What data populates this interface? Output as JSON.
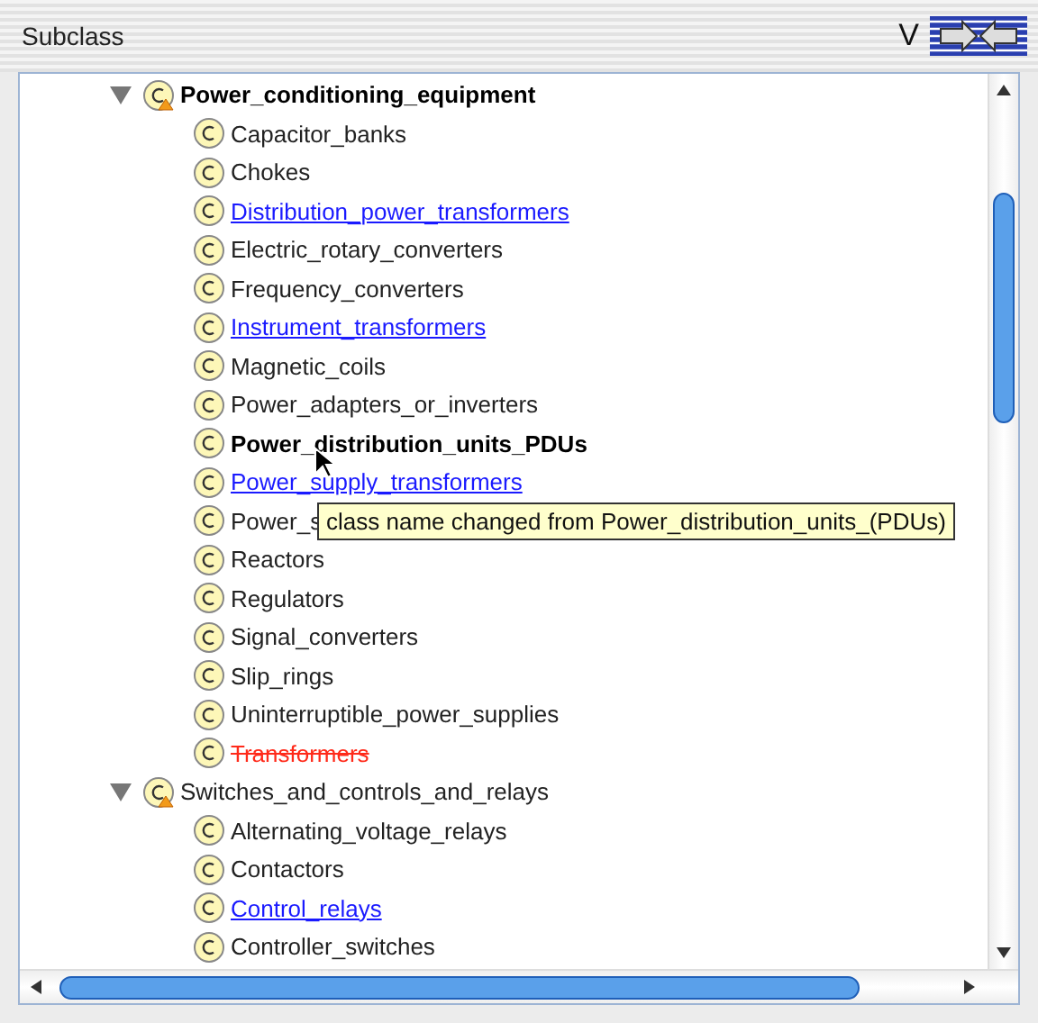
{
  "panel": {
    "title": "Subclass",
    "view_label": "V"
  },
  "tree": [
    {
      "label": "Power_conditioning_equipment",
      "kind": "bold",
      "expanded": true,
      "warning": true,
      "children": [
        {
          "label": "Capacitor_banks",
          "kind": "normal"
        },
        {
          "label": "Chokes",
          "kind": "normal"
        },
        {
          "label": "Distribution_power_transformers",
          "kind": "link"
        },
        {
          "label": "Electric_rotary_converters",
          "kind": "normal"
        },
        {
          "label": "Frequency_converters",
          "kind": "normal"
        },
        {
          "label": "Instrument_transformers",
          "kind": "link"
        },
        {
          "label": "Magnetic_coils",
          "kind": "normal"
        },
        {
          "label": "Power_adapters_or_inverters",
          "kind": "normal"
        },
        {
          "label": "Power_distribution_units_PDUs",
          "kind": "bold"
        },
        {
          "label": "Power_supply_transformers",
          "kind": "link"
        },
        {
          "label": "Power_s",
          "kind": "normal"
        },
        {
          "label": "Reactors",
          "kind": "normal"
        },
        {
          "label": "Regulators",
          "kind": "normal"
        },
        {
          "label": "Signal_converters",
          "kind": "normal"
        },
        {
          "label": "Slip_rings",
          "kind": "normal"
        },
        {
          "label": "Uninterruptible_power_supplies",
          "kind": "normal"
        },
        {
          "label": "Transformers",
          "kind": "deleted"
        }
      ]
    },
    {
      "label": "Switches_and_controls_and_relays",
      "kind": "normal",
      "expanded": true,
      "warning": true,
      "children": [
        {
          "label": "Alternating_voltage_relays",
          "kind": "normal"
        },
        {
          "label": "Contactors",
          "kind": "normal"
        },
        {
          "label": "Control_relays",
          "kind": "link"
        },
        {
          "label": "Controller_switches",
          "kind": "normal"
        }
      ]
    }
  ],
  "tooltip": {
    "text": "class name changed from Power_distribution_units_(PDUs)"
  }
}
